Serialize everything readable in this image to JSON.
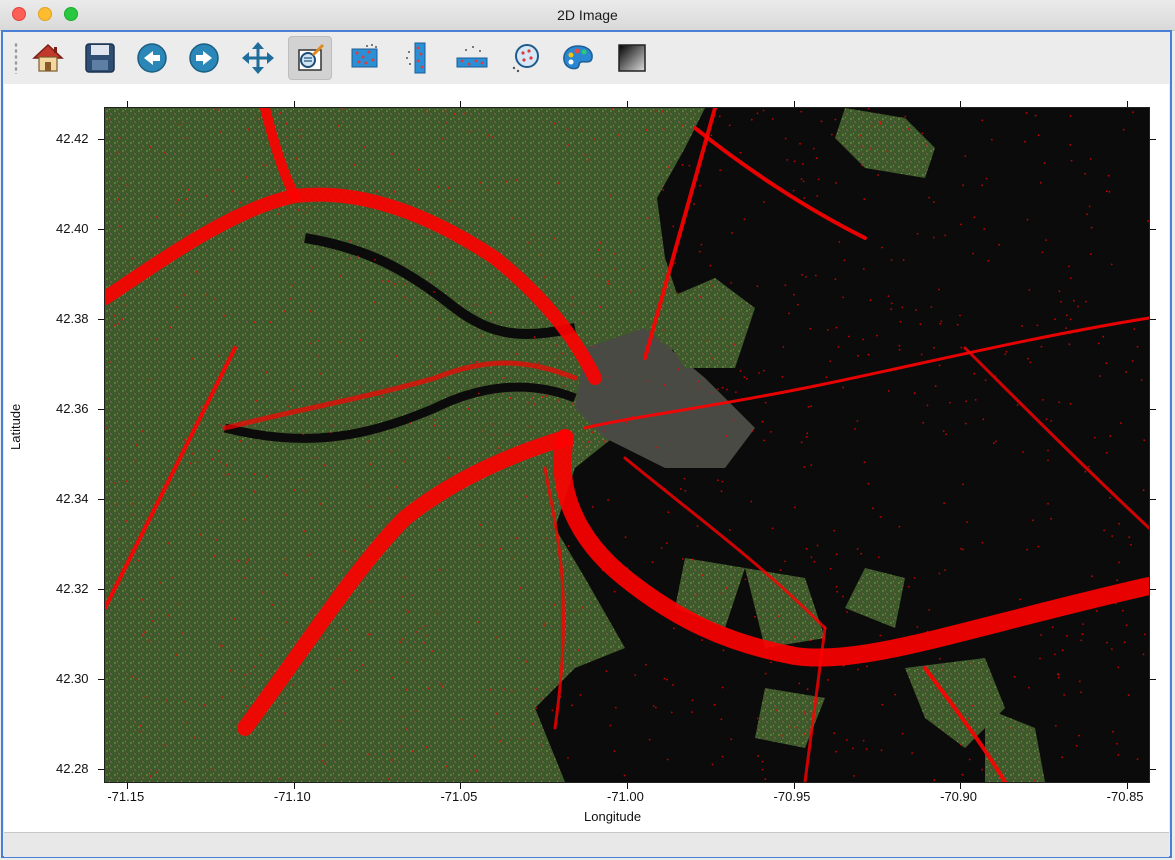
{
  "window": {
    "title": "2D Image"
  },
  "toolbar": {
    "buttons": [
      {
        "icon": "home-icon",
        "active": false
      },
      {
        "icon": "save-icon",
        "active": false
      },
      {
        "icon": "back-arrow-icon",
        "active": false
      },
      {
        "icon": "forward-arrow-icon",
        "active": false
      },
      {
        "icon": "pan-icon",
        "active": false
      },
      {
        "icon": "zoom-icon",
        "active": true
      },
      {
        "icon": "scatter-icon",
        "active": false
      },
      {
        "icon": "vertical-profile-icon",
        "active": false
      },
      {
        "icon": "horizontal-profile-icon",
        "active": false
      },
      {
        "icon": "point-select-icon",
        "active": false
      },
      {
        "icon": "palette-icon",
        "active": false
      },
      {
        "icon": "gradient-icon",
        "active": false
      }
    ]
  },
  "plot": {
    "xlabel": "Longitude",
    "ylabel": "Latitude",
    "xticks": [
      "-71.15",
      "-71.10",
      "-71.05",
      "-71.00",
      "-70.95",
      "-70.90",
      "-70.85"
    ],
    "yticks": [
      "42.42",
      "42.40",
      "42.38",
      "42.36",
      "42.34",
      "42.32",
      "42.30",
      "42.28"
    ],
    "xlim": [
      -71.157,
      -70.843
    ],
    "ylim": [
      42.277,
      42.427
    ],
    "point_color": "#ff0000",
    "water_color": "#0b0b0b",
    "land_color": "#3f5a2a"
  }
}
